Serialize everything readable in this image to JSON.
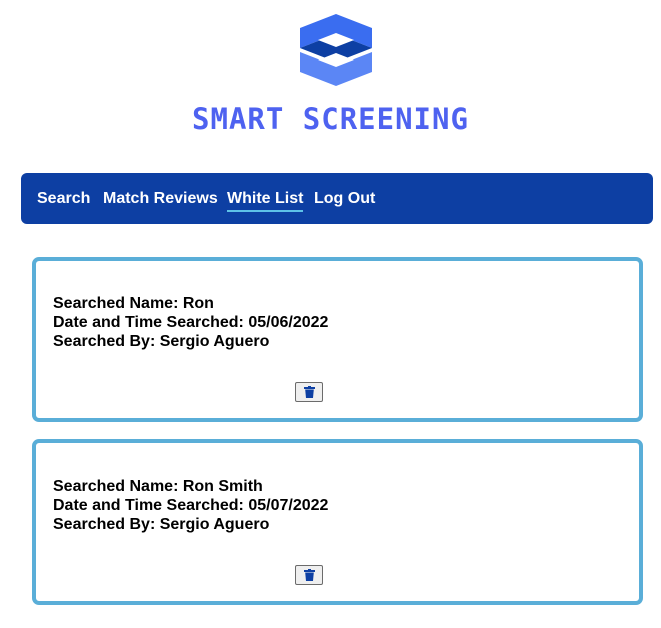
{
  "logo": {
    "text": "SMART SCREENING",
    "mark_icon": "s-cube-logo-icon",
    "colors": {
      "dark": "#0d3fa3",
      "mid": "#3a6df0",
      "light": "#5b86f5",
      "text": "#4e62f0"
    }
  },
  "nav": {
    "background": "#0d3fa3",
    "items": [
      {
        "label": "Search"
      },
      {
        "label": "Match Reviews"
      },
      {
        "label": "White List",
        "active": true
      },
      {
        "label": "Log Out"
      }
    ]
  },
  "white_list": [
    {
      "name_line": "Searched Name: Ron",
      "date_line": "Date and Time Searched: 05/06/2022",
      "by_line": "Searched By: Sergio Aguero",
      "delete_icon": "trash-icon"
    },
    {
      "name_line": "Searched Name: Ron Smith",
      "date_line": "Date and Time Searched: 05/07/2022",
      "by_line": "Searched By: Sergio Aguero",
      "delete_icon": "trash-icon"
    }
  ],
  "colors": {
    "card_border": "#5aaed8",
    "active_underline": "#5ec2e8"
  }
}
